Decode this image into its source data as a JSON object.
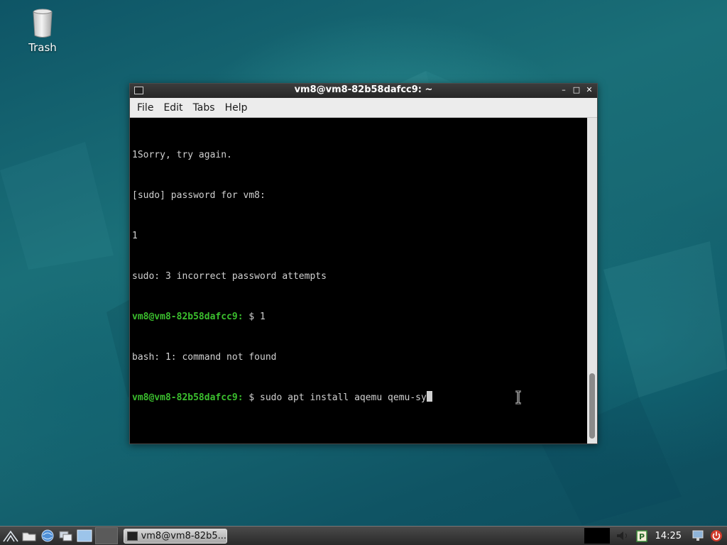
{
  "desktop": {
    "icons": [
      {
        "label": "Trash",
        "icon": "trash-icon"
      }
    ]
  },
  "terminal": {
    "title": "vm8@vm8-82b58dafcc9: ~",
    "menu": [
      "File",
      "Edit",
      "Tabs",
      "Help"
    ],
    "window_controls": {
      "minimize": "–",
      "maximize": "□",
      "close": "✕"
    },
    "lines": [
      {
        "text": "1Sorry, try again."
      },
      {
        "text": "[sudo] password for vm8:"
      },
      {
        "text": "1"
      },
      {
        "text": "sudo: 3 incorrect password attempts"
      },
      {
        "prompt": "vm8@vm8-82b58dafcc9:",
        "text": " $ 1"
      },
      {
        "text": "bash: 1: command not found"
      },
      {
        "prompt": "vm8@vm8-82b58dafcc9:",
        "text": " $ sudo apt install aqemu qemu-sy"
      }
    ],
    "colors": {
      "prompt": "#3bbf2e",
      "text": "#d0d0d0",
      "background": "#000000"
    },
    "scroll_position": 0.92
  },
  "taskbar": {
    "launchers": [
      "start-menu-icon",
      "file-manager-icon",
      "web-browser-icon",
      "show-desktop-icon",
      "workspace-icon"
    ],
    "task_label": "vm8@vm8-82b5...",
    "clock": "14:25",
    "tray_icons": [
      "volume-icon",
      "clipboard-icon",
      "network-icon",
      "power-icon"
    ]
  }
}
